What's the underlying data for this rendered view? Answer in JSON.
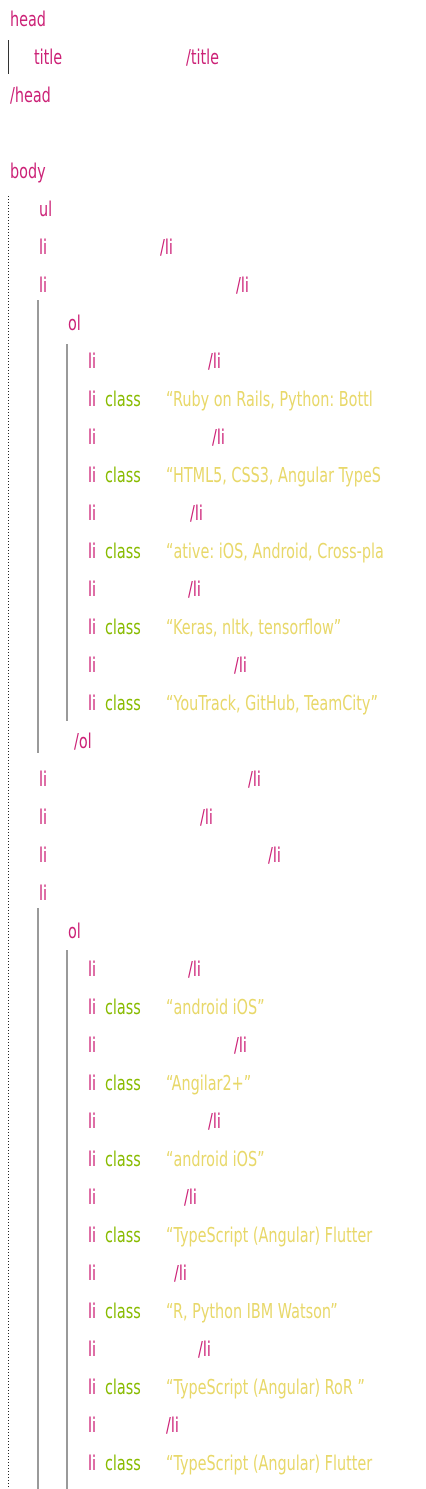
{
  "head": {
    "open": "head",
    "close": "/head"
  },
  "title": {
    "open": "title",
    "close": "/title"
  },
  "body": {
    "open": "body"
  },
  "ul": {
    "open": "ul"
  },
  "ol": {
    "open": "ol",
    "close": "/ol"
  },
  "li": {
    "open": "li",
    "close": "/li"
  },
  "attr": {
    "class": "class"
  },
  "group1_strings": [
    "“Ruby on Rails, Python: Bottl",
    "“HTML5, CSS3, Angular TypeS",
    "“ative: iOS, Android, Cross-pla",
    "“Keras, nltk, tensorflow”",
    "“YouTrack, GitHub, TeamCity”"
  ],
  "group2_strings": [
    "“android iOS”",
    "“Angilar2+”",
    "“android iOS”",
    "“TypeScript (Angular) Flutter",
    "“R, Python IBM Watson”",
    "“TypeScript (Angular) RoR ”",
    "“TypeScript (Angular) Flutter"
  ]
}
